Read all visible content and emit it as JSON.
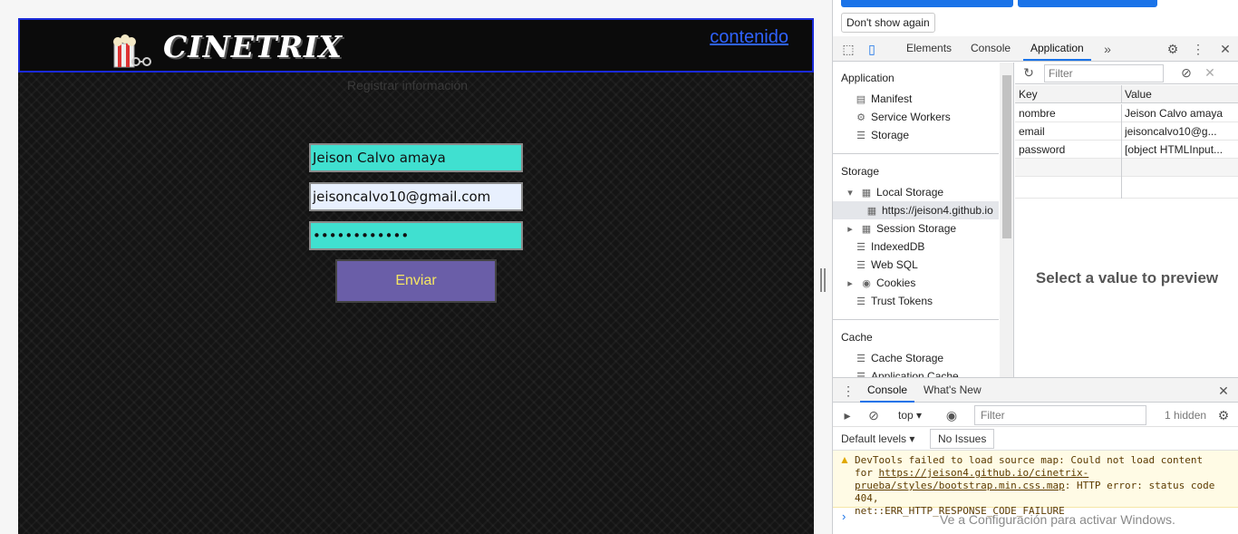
{
  "site": {
    "logo_text": "CINETRIX",
    "nav_link": "contenido",
    "subtitle": "Registrar información",
    "form": {
      "name_value": "Jeison Calvo amaya",
      "email_value": "jeisoncalvo10@gmail.com",
      "password_value": "••••••••••••",
      "submit_label": "Enviar"
    }
  },
  "devtools": {
    "banner": {
      "dont_show": "Don't show again"
    },
    "tabs": [
      "Elements",
      "Console",
      "Application"
    ],
    "active_tab": "Application",
    "sidebar": {
      "application_title": "Application",
      "application_items": [
        "Manifest",
        "Service Workers",
        "Storage"
      ],
      "storage_title": "Storage",
      "storage_items": [
        "Local Storage",
        "https://jeison4.github.io",
        "Session Storage",
        "IndexedDB",
        "Web SQL",
        "Cookies",
        "Trust Tokens"
      ],
      "cache_title": "Cache",
      "cache_items": [
        "Cache Storage",
        "Application Cache"
      ]
    },
    "kv": {
      "filter_placeholder": "Filter",
      "col_key": "Key",
      "col_value": "Value",
      "rows": [
        {
          "key": "nombre",
          "value": "Jeison Calvo amaya"
        },
        {
          "key": "email",
          "value": "jeisoncalvo10@g..."
        },
        {
          "key": "password",
          "value": "[object HTMLInput..."
        }
      ],
      "preview": "Select a value to preview"
    },
    "drawer": {
      "tabs": [
        "Console",
        "What's New"
      ],
      "context": "top",
      "filter_placeholder": "Filter",
      "hidden_count": "1 hidden",
      "levels": "Default levels",
      "issues": "No Issues",
      "warning_prefix": "DevTools failed to load source map: Could not load content\nfor ",
      "warning_link": "https://jeison4.github.io/cinetrix-prueba/styles/bootstrap.min.css.map",
      "warning_suffix": ": HTTP error: status code 404,\nnet::ERR_HTTP_RESPONSE_CODE_FAILURE",
      "watermark": "Ve a Configuración para activar Windows."
    }
  }
}
